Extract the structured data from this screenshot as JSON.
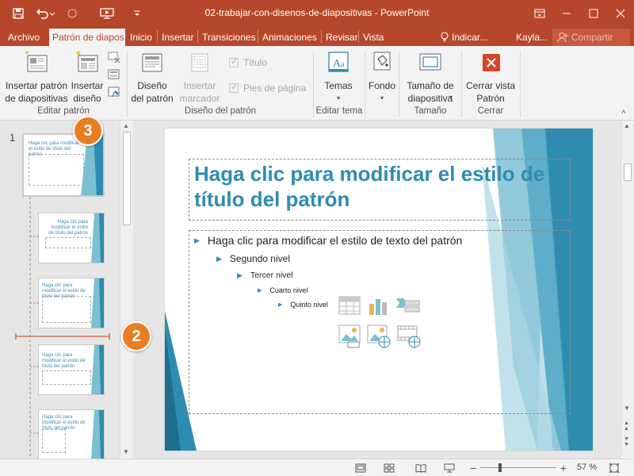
{
  "window": {
    "title": "02-trabajar-con-disenos-de-diapositivas - PowerPoint"
  },
  "tabs": [
    {
      "label": "Archivo"
    },
    {
      "label": "Patrón de diapos"
    },
    {
      "label": "Inicio"
    },
    {
      "label": "Insertar"
    },
    {
      "label": "Transiciones"
    },
    {
      "label": "Animaciones"
    },
    {
      "label": "Revisar"
    },
    {
      "label": "Vista"
    }
  ],
  "tellme": "Indicar...",
  "user": "Kayla...",
  "share": "Compartir",
  "ribbon": {
    "insert_master_l1": "Insertar patrón",
    "insert_master_l2": "de diapositivas",
    "insert_layout_l1": "Insertar",
    "insert_layout_l2": "diseño",
    "group_edit_master": "Editar patrón",
    "master_layout_l1": "Diseño",
    "master_layout_l2": "del patrón",
    "insert_placeholder_l1": "Insertar",
    "insert_placeholder_l2": "marcador",
    "chk_title": "Título",
    "chk_footers": "Pies de página",
    "group_master_layout": "Diseño del patrón",
    "themes": "Temas",
    "group_edit_theme": "Editar tema",
    "background": "Fondo",
    "slide_size_l1": "Tamaño de",
    "slide_size_l2": "diapositiva",
    "group_size": "Tamaño",
    "close_master_l1": "Cerrar vista",
    "close_master_l2": "Patrón",
    "group_close": "Cerrar"
  },
  "thumbs": {
    "slide_number": "1",
    "t1": "Haga clic para modificar el estilo de título del patrón",
    "t2": "Haga clic para modificar el estilo de título del patrón",
    "t3": "Haga clic para modificar el estilo de título del patrón",
    "t4": "Haga clic para modificar el estilo de título del patrón",
    "t5": "Haga clic para modificar el estilo de título del patrón"
  },
  "slide": {
    "title": "Haga clic para modificar el estilo de título del patrón",
    "level1": "Haga clic para modificar el estilo de texto del patrón",
    "level2": "Segundo nivel",
    "level3": "Tercer nivel",
    "level4": "Cuarto nivel",
    "level5": "Quinto nivel"
  },
  "callouts": {
    "c2": "2",
    "c3": "3"
  },
  "status": {
    "zoom": "57 %"
  },
  "colors": {
    "accent": "#b7472a",
    "slide_blue": "#2f8cb1",
    "callout": "#e67e22"
  }
}
